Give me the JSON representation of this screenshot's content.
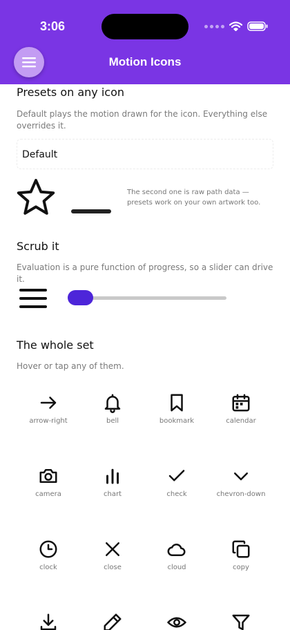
{
  "status_bar": {
    "time": "3:06"
  },
  "header": {
    "title": "Motion Icons"
  },
  "presets": {
    "title": "Presets on any icon",
    "description": "Default plays the motion drawn for the icon. Everything else overrides it.",
    "preset_value": "Default",
    "note": "The second one is raw path data — presets work on your own artwork too."
  },
  "scrub": {
    "title": "Scrub it",
    "description": "Evaluation is a pure function of progress, so a slider can drive it.",
    "progress": 0.05
  },
  "icon_set": {
    "title": "The whole set",
    "description": "Hover or tap any of them.",
    "icons": [
      {
        "label": "arrow-right"
      },
      {
        "label": "bell"
      },
      {
        "label": "bookmark"
      },
      {
        "label": "calendar"
      },
      {
        "label": "camera"
      },
      {
        "label": "chart"
      },
      {
        "label": "check"
      },
      {
        "label": "chevron-down"
      },
      {
        "label": "clock"
      },
      {
        "label": "close"
      },
      {
        "label": "cloud"
      },
      {
        "label": "copy"
      },
      {
        "label": ""
      },
      {
        "label": ""
      },
      {
        "label": ""
      },
      {
        "label": ""
      }
    ]
  }
}
